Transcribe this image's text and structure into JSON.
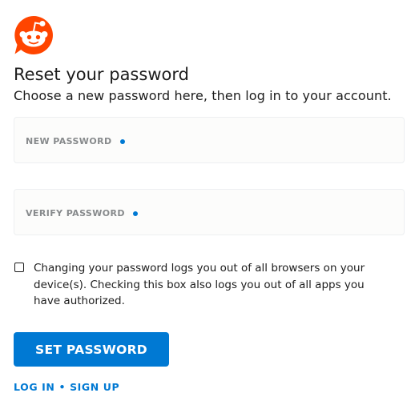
{
  "logo": {
    "name": "reddit-snoo-logo",
    "color": "#ff4500"
  },
  "header": {
    "title": "Reset your password",
    "subtitle": "Choose a new password here, then log in to your account."
  },
  "form": {
    "new_password": {
      "label": "NEW PASSWORD",
      "value": ""
    },
    "verify_password": {
      "label": "VERIFY PASSWORD",
      "value": ""
    },
    "logout_checkbox": {
      "checked": false,
      "text": "Changing your password logs you out of all browsers on your device(s). Checking this box also logs you out of all apps you have authorized."
    },
    "submit_label": "SET PASSWORD"
  },
  "footer": {
    "login_label": "LOG IN",
    "separator": "•",
    "signup_label": "SIGN UP"
  },
  "colors": {
    "accent": "#0079d3",
    "brand": "#ff4500",
    "text": "#1c1c1c",
    "label": "#878a8c"
  }
}
